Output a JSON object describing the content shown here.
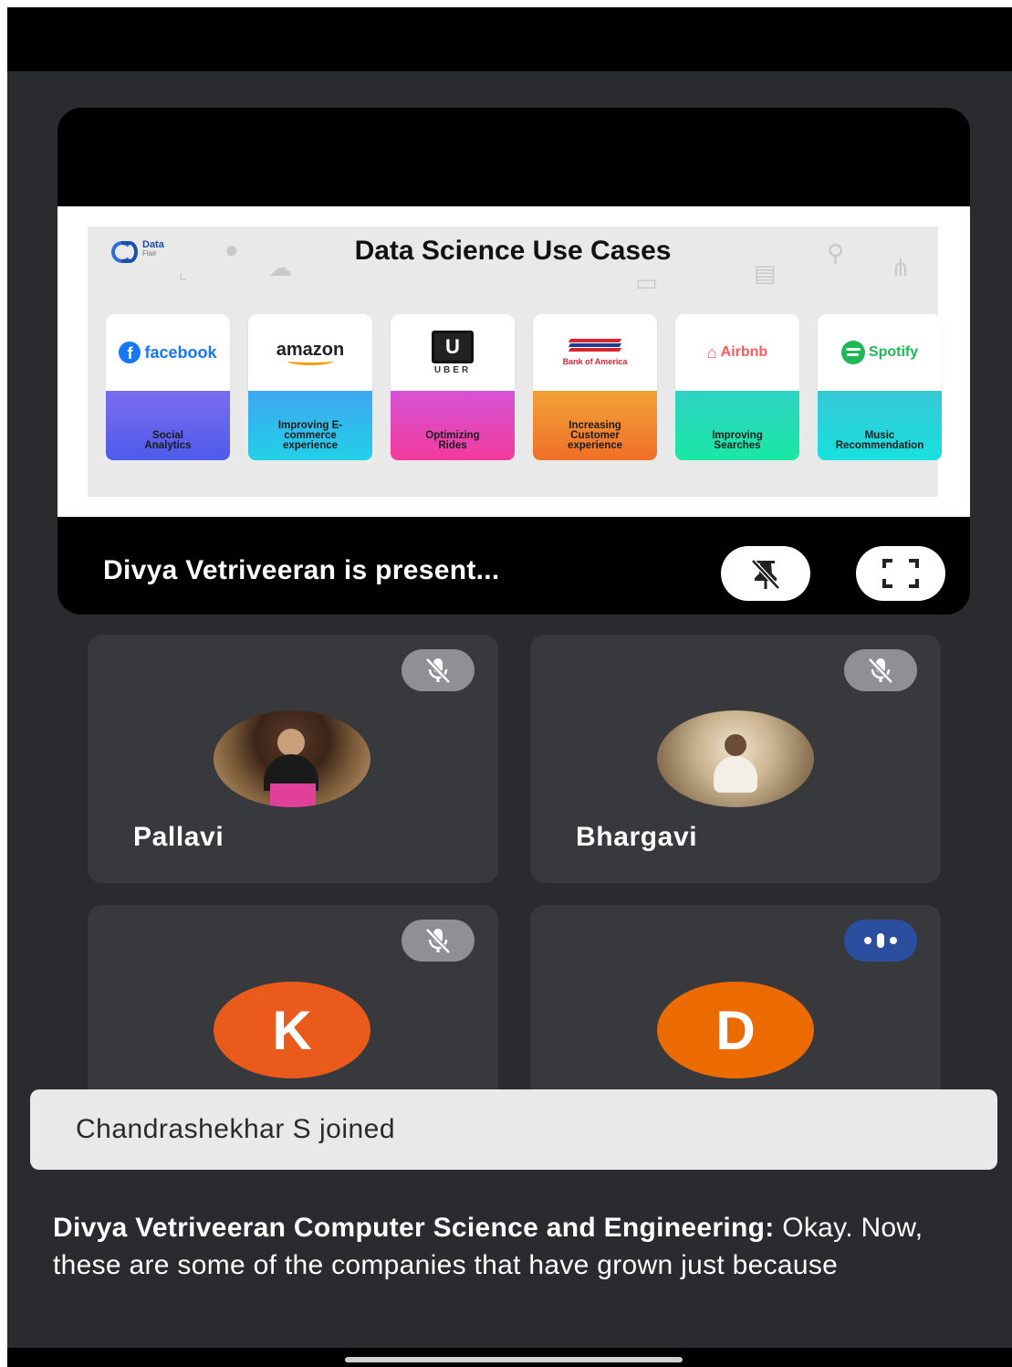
{
  "slide": {
    "title": "Data Science Use Cases",
    "logo_line1": "Data",
    "logo_line2": "Flair",
    "use_cases": [
      {
        "brand": "facebook",
        "description": "Social Analytics",
        "color_top": "#7a6cf0",
        "color_bottom": "#4e5bea"
      },
      {
        "brand": "amazon",
        "description": "Improving E-commerce experience",
        "color_top": "#3fa6f0",
        "color_bottom": "#22d0e8"
      },
      {
        "brand": "UBER",
        "description": "Optimizing Rides",
        "color_top": "#d653d6",
        "color_bottom": "#f23a9c"
      },
      {
        "brand": "Bank of America",
        "description": "Increasing Customer experience",
        "color_top": "#f2a13a",
        "color_bottom": "#f06f27"
      },
      {
        "brand": "Airbnb",
        "description": "Improving Searches",
        "color_top": "#2fd2c4",
        "color_bottom": "#19e8a4"
      },
      {
        "brand": "Spotify",
        "description": "Music Recommendation",
        "color_top": "#36c8d6",
        "color_bottom": "#18e0de"
      }
    ]
  },
  "presenter": {
    "label": "Divya Vetriveeran is present..."
  },
  "participants": [
    {
      "name": "Pallavi",
      "mic": "muted"
    },
    {
      "name": "Bhargavi",
      "mic": "muted"
    },
    {
      "initial": "K",
      "mic": "muted"
    },
    {
      "initial": "D",
      "mic": "speaking"
    }
  ],
  "toast": {
    "text": "Chandrashekhar S joined"
  },
  "caption": {
    "speaker": "Divya Vetriveeran Computer Science and Engineering:",
    "text": "Okay. Now, these are some of the companies that have grown just because"
  },
  "colors": {
    "background": "#2a2b2e",
    "tile": "#38393d",
    "mic_muted": "#8e9096",
    "mic_active": "#2c4e9e",
    "avatar_k": "#ea5a1a",
    "avatar_d": "#ec6b00"
  }
}
